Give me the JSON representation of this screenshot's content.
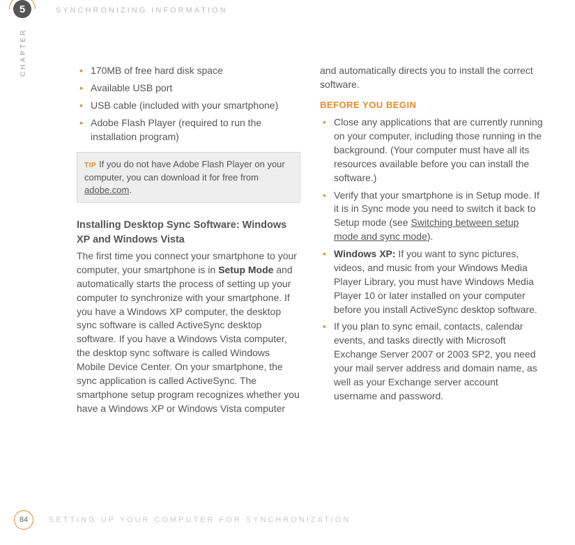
{
  "header": {
    "chapter_number": "5",
    "title": "SYNCHRONIZING INFORMATION",
    "sidebar_label": "CHAPTER"
  },
  "column1": {
    "bullets": [
      "170MB of free hard disk space",
      "Available USB port",
      "USB cable (included with your smartphone)",
      "Adobe Flash Player (required to run the installation program)"
    ],
    "tip_label": "TIP",
    "tip_text_before": "If you do not have Adobe Flash Player on your computer, you can download it for free from ",
    "tip_link": "adobe.com",
    "tip_text_after": ".",
    "subhead": "Installing Desktop Sync Software: Windows XP and Windows Vista",
    "para_before_bold": "The first time you connect your smartphone to your computer, your smartphone is in ",
    "bold": "Setup Mode",
    "para_after_bold": " and automatically starts the process of setting up your computer to synchronize with your smartphone. If you have a Windows XP computer, the desktop sync software is called ActiveSync desktop software. If you have a Windows Vista computer, the desktop sync software is called Windows Mobile Device Center. On your smartphone, the sync application is called ActiveSync. The smartphone setup program recognizes whether you have a Windows XP or Windows Vista computer"
  },
  "column2": {
    "lead": "and automatically directs you to install the correct software.",
    "section_label": "BEFORE YOU BEGIN",
    "b1": "Close any applications that are currently running on your computer, including those running in the background. (Your computer must have all its resources available before you can install the software.)",
    "b2_before": "Verify that your smartphone is in Setup mode. If it is in Sync mode you need to switch it back to Setup mode (see ",
    "b2_link": "Switching between setup mode and sync mode",
    "b2_after": ").",
    "b3_bold": "Windows XP:",
    "b3_rest": " If you want to sync pictures, videos, and music from your Windows Media Player Library, you must have Windows Media Player 10 or later installed on your computer before you install ActiveSync desktop software.",
    "b4": "If you plan to sync email, contacts, calendar events, and tasks directly with Microsoft Exchange Server 2007 or 2003 SP2, you need your mail server address and domain name, as well as your Exchange server account username and password."
  },
  "footer": {
    "page": "84",
    "title": "SETTING UP YOUR COMPUTER FOR SYNCHRONIZATION"
  }
}
